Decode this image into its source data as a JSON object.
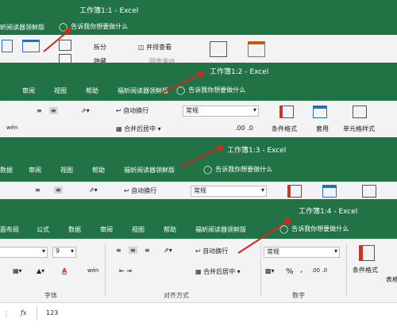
{
  "windows": [
    {
      "title": "工作簿1:1  -  Excel",
      "ribbon": {
        "split": "拆分",
        "side_by_side": "并排查看",
        "hide": "隐藏",
        "sync": "同步滚动"
      },
      "tell_me": "告诉我你想要做什么",
      "tab_reader": "福昕阅读器领鲜版"
    },
    {
      "title": "工作簿1:2  -  Excel",
      "tabs": [
        "审阅",
        "视图",
        "帮助",
        "福昕阅读器领鲜版"
      ],
      "tell_me": "告诉我你想要做什么",
      "ribbon": {
        "wrap": "自动换行",
        "merge": "合并后居中",
        "number_format": "常规",
        "cond_format": "条件格式",
        "table_format": "套用",
        "cell_style": "单元格样式",
        "phonetic": "wén",
        "decimals": ".00  .0"
      }
    },
    {
      "title": "工作簿1:3  -  Excel",
      "tabs": [
        "数据",
        "审阅",
        "视图",
        "帮助",
        "福昕阅读器领鲜版"
      ],
      "tell_me": "告诉我你想要做什么",
      "ribbon": {
        "wrap": "自动换行",
        "number_format": "常规"
      }
    },
    {
      "title": "工作簿1:4  -  Excel",
      "tabs": [
        "面布局",
        "公式",
        "数据",
        "审阅",
        "视图",
        "帮助",
        "福昕阅读器领鲜版"
      ],
      "tell_me": "告诉我你想要做什么",
      "ribbon": {
        "font_size": "9",
        "wrap": "自动换行",
        "merge": "合并后居中",
        "number_format": "常规",
        "percent": "%",
        "comma": ",",
        "cond_format": "条件格式",
        "table_format": "表格",
        "group_font": "字体",
        "group_align": "对齐方式",
        "group_number": "数字",
        "phonetic": "wén",
        "font_color": "A",
        "decimals": ".00  .0"
      },
      "formula_bar": {
        "fx": "fx",
        "value": "123"
      }
    }
  ],
  "colors": {
    "excel_green": "#217346",
    "arrow_red": "#d8261c"
  }
}
